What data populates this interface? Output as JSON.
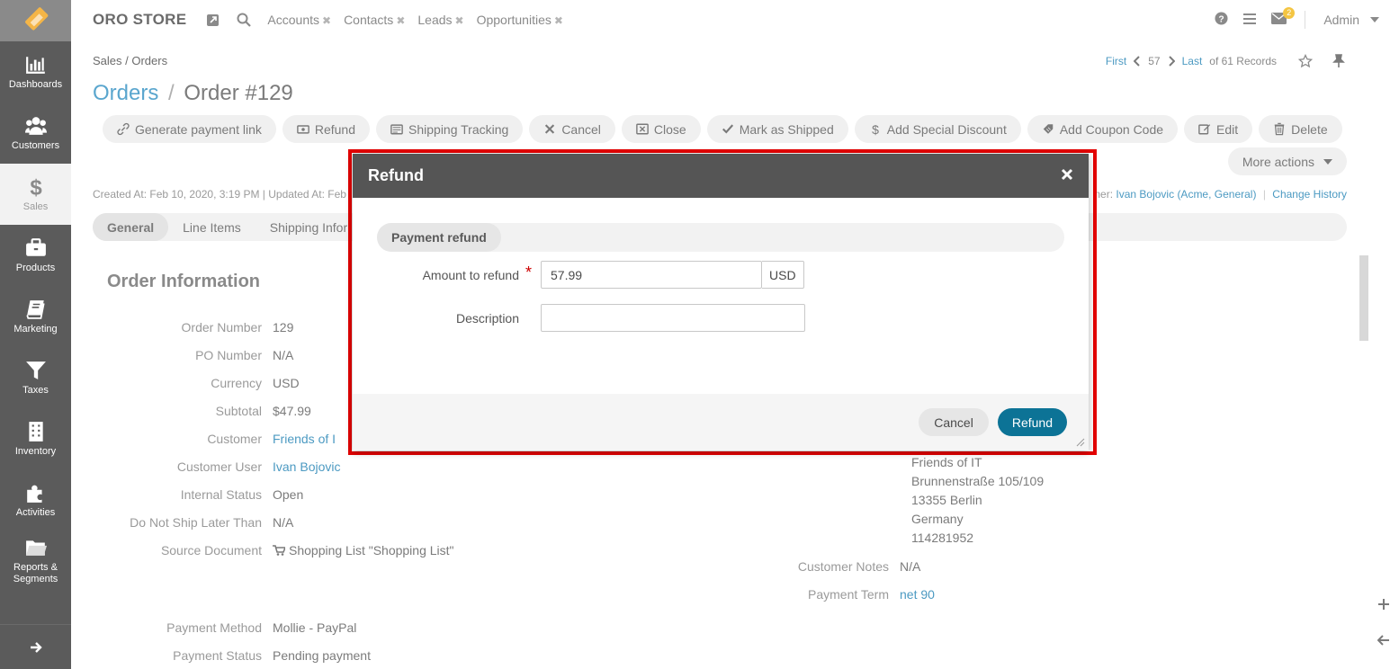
{
  "app": {
    "brand": "ORO STORE",
    "user": "Admin",
    "mail_count": "2"
  },
  "shortcuts": [
    "Accounts",
    "Contacts",
    "Leads",
    "Opportunities"
  ],
  "sidebar": [
    {
      "label": "Dashboards",
      "icon": "bar-chart-icon"
    },
    {
      "label": "Customers",
      "icon": "users-icon"
    },
    {
      "label": "Sales",
      "icon": "dollar-icon"
    },
    {
      "label": "Products",
      "icon": "briefcase-icon"
    },
    {
      "label": "Marketing",
      "icon": "book-icon"
    },
    {
      "label": "Taxes",
      "icon": "filter-icon"
    },
    {
      "label": "Inventory",
      "icon": "building-icon"
    },
    {
      "label": "Activities",
      "icon": "puzzle-icon"
    },
    {
      "label": "Reports & Segments",
      "icon": "folder-icon"
    }
  ],
  "breadcrumb": "Sales / Orders",
  "pager": {
    "first": "First",
    "current": "57",
    "last": "Last",
    "total": "of 61 Records"
  },
  "title": {
    "section": "Orders",
    "separator": "/",
    "record": "Order #129"
  },
  "actions": [
    "Generate payment link",
    "Refund",
    "Shipping Tracking",
    "Cancel",
    "Close",
    "Mark as Shipped",
    "Add Special Discount",
    "Add Coupon Code",
    "Edit",
    "Delete"
  ],
  "more_actions": "More actions",
  "meta": {
    "left": "Created At: Feb 10, 2020, 3:19 PM  |  Updated At: Feb",
    "owner_prefix": "ner:",
    "owner": "Ivan Bojovic",
    "owner_org": "(Acme, General)",
    "change_history": "Change History"
  },
  "tabs": [
    "General",
    "Line Items",
    "Shipping Infor"
  ],
  "section_title": "Order Information",
  "fields": [
    {
      "label": "Order Number",
      "value": "129"
    },
    {
      "label": "PO Number",
      "value": "N/A"
    },
    {
      "label": "Currency",
      "value": "USD"
    },
    {
      "label": "Subtotal",
      "value": "$47.99"
    },
    {
      "label": "Customer",
      "value": "Friends of I"
    },
    {
      "label": "Customer User",
      "value": "Ivan Bojovic"
    },
    {
      "label": "Internal Status",
      "value": "Open"
    },
    {
      "label": "Do Not Ship Later Than",
      "value": "N/A"
    },
    {
      "label": "Source Document",
      "value": "Shopping List \"Shopping List\""
    }
  ],
  "fields2": [
    {
      "label": "Payment Method",
      "value": "Mollie - PayPal"
    },
    {
      "label": "Payment Status",
      "value": "Pending payment"
    }
  ],
  "address": [
    "Friends of IT",
    "Brunnenstraße 105/109",
    "13355 Berlin",
    "Germany",
    "114281952"
  ],
  "right_fields": [
    {
      "label": "Customer Notes",
      "value": "N/A"
    },
    {
      "label": "Payment Term",
      "value": "net 90"
    }
  ],
  "dialog": {
    "title": "Refund",
    "section": "Payment refund",
    "amount_label": "Amount to refund",
    "amount_value": "57.99",
    "currency": "USD",
    "description_label": "Description",
    "description_value": "",
    "cancel": "Cancel",
    "submit": "Refund"
  },
  "colors": {
    "accent": "#0c7396",
    "link": "#4c9ac2",
    "highlight": "#e40000"
  }
}
